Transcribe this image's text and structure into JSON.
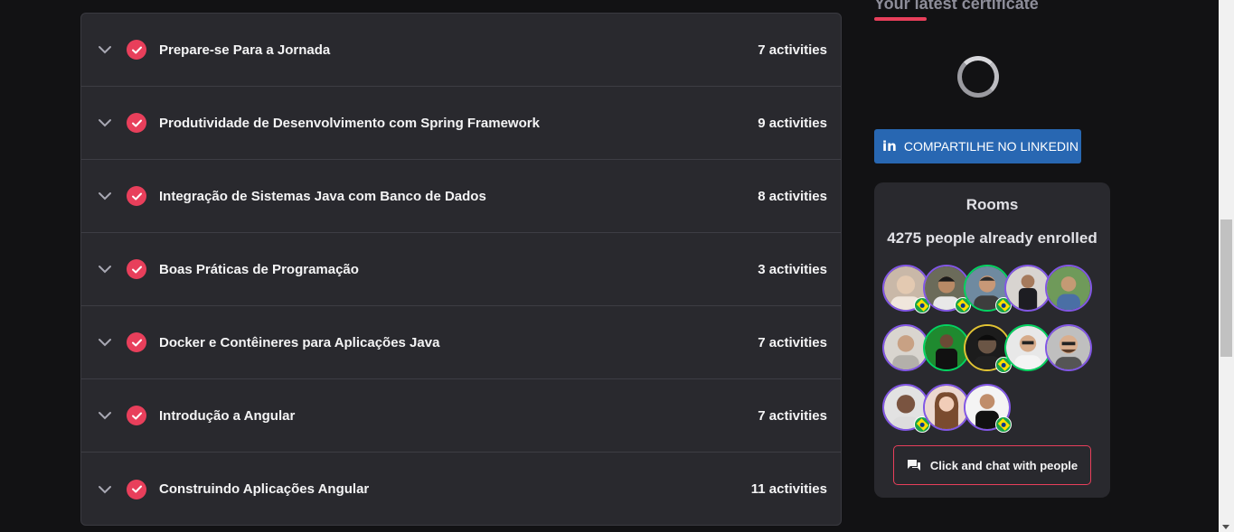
{
  "modules": [
    {
      "title": "Prepare-se Para a Jornada",
      "count": "7 activities"
    },
    {
      "title": "Produtividade de Desenvolvimento com Spring Framework",
      "count": "9 activities"
    },
    {
      "title": "Integração de Sistemas Java com Banco de Dados",
      "count": "8 activities"
    },
    {
      "title": "Boas Práticas de Programação",
      "count": "3 activities"
    },
    {
      "title": "Docker e Contêineres para Aplicações Java",
      "count": "7 activities"
    },
    {
      "title": "Introdução a Angular",
      "count": "7 activities"
    },
    {
      "title": "Construindo Aplicações Angular",
      "count": "11 activities"
    }
  ],
  "certificate": {
    "title": "Your latest certificate",
    "linkedin_label": "COMPARTILHE NO LINKEDIN",
    "linkedin_icon": "in"
  },
  "rooms": {
    "title": "Rooms",
    "enrolled": "4275 people already enrolled",
    "chat_label": "Click and chat with people"
  },
  "colors": {
    "accent": "#e83f5b",
    "panel": "#29292e",
    "background": "#121214",
    "linkedin": "#2867b2",
    "avatar_ring": "#8257e5"
  }
}
